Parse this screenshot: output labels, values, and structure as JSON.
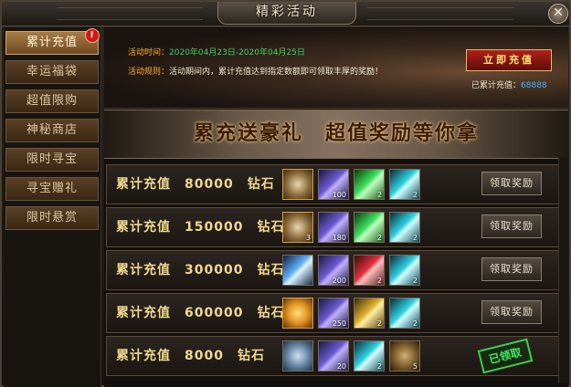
{
  "window": {
    "title": "精彩活动",
    "close_label": "✕"
  },
  "sidebar": {
    "items": [
      {
        "label": "累计充值",
        "active": true,
        "badge": "!"
      },
      {
        "label": "幸运福袋"
      },
      {
        "label": "超值限购"
      },
      {
        "label": "神秘商店"
      },
      {
        "label": "限时寻宝"
      },
      {
        "label": "寻宝赠礼"
      },
      {
        "label": "限时悬赏"
      }
    ]
  },
  "info": {
    "time_label": "活动时间：",
    "time_value": "2020年04月23日-2020年04月25日",
    "rule_label": "活动规则：",
    "rule_text": "活动期间内，累计充值达到指定数额即可领取丰厚的奖励！",
    "recharge_button": "立即充值",
    "total_label": "已累计充值：",
    "total_value": "68888"
  },
  "banner": {
    "text": "累充送豪礼　超值奖励等你拿"
  },
  "rows": [
    {
      "label": "累计充值　80000　钻石",
      "items": [
        {
          "icon": "medal-icon",
          "count": ""
        },
        {
          "icon": "feather-icon",
          "count": "100"
        },
        {
          "icon": "green-gem-icon",
          "count": "2"
        },
        {
          "icon": "cyan-gem-icon",
          "count": "2"
        }
      ],
      "action": "领取奖励"
    },
    {
      "label": "累计充值　150000　钻石",
      "items": [
        {
          "icon": "medal-icon",
          "count": "3"
        },
        {
          "icon": "feather-icon",
          "count": "180"
        },
        {
          "icon": "green-gem-icon",
          "count": "2"
        },
        {
          "icon": "cyan-gem-icon",
          "count": "2"
        }
      ],
      "action": "领取奖励"
    },
    {
      "label": "累计充值　300000　钻石",
      "items": [
        {
          "icon": "crystal-icon",
          "count": ""
        },
        {
          "icon": "feather-icon",
          "count": "200"
        },
        {
          "icon": "red-gem-icon",
          "count": "2"
        },
        {
          "icon": "cyan-gem-icon",
          "count": "2"
        }
      ],
      "action": "领取奖励"
    },
    {
      "label": "累计充值　600000　钻石",
      "items": [
        {
          "icon": "amber-gem-icon",
          "count": ""
        },
        {
          "icon": "feather-icon",
          "count": "250"
        },
        {
          "icon": "gold-gem-icon",
          "count": "2"
        },
        {
          "icon": "cyan-gem-icon",
          "count": "2"
        }
      ],
      "action": "领取奖励"
    },
    {
      "label": "累计充值　8000　钻石",
      "items": [
        {
          "icon": "compass-icon",
          "count": ""
        },
        {
          "icon": "feather-icon",
          "count": "20"
        },
        {
          "icon": "cyan-gem-icon",
          "count": "2"
        },
        {
          "icon": "scroll-bag-icon",
          "count": "5"
        }
      ],
      "claimed": true,
      "action": "已领取"
    }
  ],
  "colors": {
    "accent": "#d0a76a",
    "claimed": "#3fcf4f",
    "date": "#40d060",
    "total": "#40b0ff"
  }
}
